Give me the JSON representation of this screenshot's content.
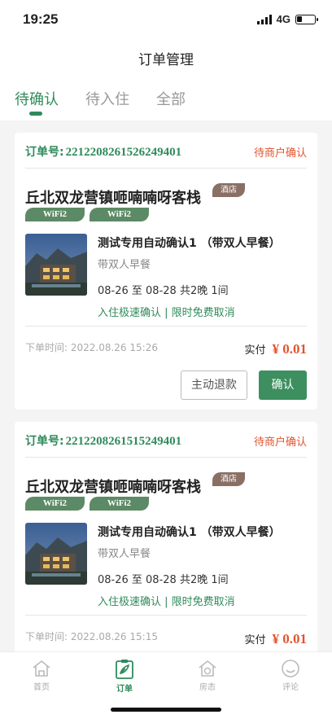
{
  "status_bar": {
    "time": "19:25",
    "network": "4G",
    "battery_level": 0.3
  },
  "header": {
    "title": "订单管理"
  },
  "tabs": [
    {
      "label": "待确认",
      "active": true
    },
    {
      "label": "待入住",
      "active": false
    },
    {
      "label": "全部",
      "active": false
    }
  ],
  "orders": [
    {
      "order_no_label": "订单号:",
      "order_no": "2212208261526249401",
      "status": "待商户确认",
      "hotel_name": "丘北双龙营镇咂喃喃呀客栈",
      "hotel_badge": "酒店",
      "tags": [
        "WiFi2",
        "WiFi2"
      ],
      "room_title": "测试专用自动确认1 （带双人早餐）",
      "room_sub": "带双人早餐",
      "dates": "08-26 至 08-28  共2晚  1间",
      "policy": "入住极速确认 | 限时免费取消",
      "order_time": "下单时间:  2022.08.26 15:26",
      "paid_label": "实付",
      "paid_amount": "¥ 0.01",
      "refund_label": "主动退款",
      "confirm_label": "确认"
    },
    {
      "order_no_label": "订单号:",
      "order_no": "2212208261515249401",
      "status": "待商户确认",
      "hotel_name": "丘北双龙营镇咂喃喃呀客栈",
      "hotel_badge": "酒店",
      "tags": [
        "WiFi2",
        "WiFi2"
      ],
      "room_title": "测试专用自动确认1 （带双人早餐）",
      "room_sub": "带双人早餐",
      "dates": "08-26 至 08-28  共2晚  1间",
      "policy": "入住极速确认 | 限时免费取消",
      "order_time": "下单时间:  2022.08.26 15:15",
      "paid_label": "实付",
      "paid_amount": "¥ 0.01"
    }
  ],
  "tabbar": [
    {
      "label": "首页",
      "icon": "home-icon",
      "active": false
    },
    {
      "label": "订单",
      "icon": "order-icon",
      "active": true
    },
    {
      "label": "房态",
      "icon": "room-status-icon",
      "active": false
    },
    {
      "label": "评论",
      "icon": "comment-icon",
      "active": false
    }
  ],
  "colors": {
    "accent": "#2f8a5a",
    "status": "#e2542e",
    "badge": "#8a6f65",
    "tag": "#5d8a66"
  }
}
